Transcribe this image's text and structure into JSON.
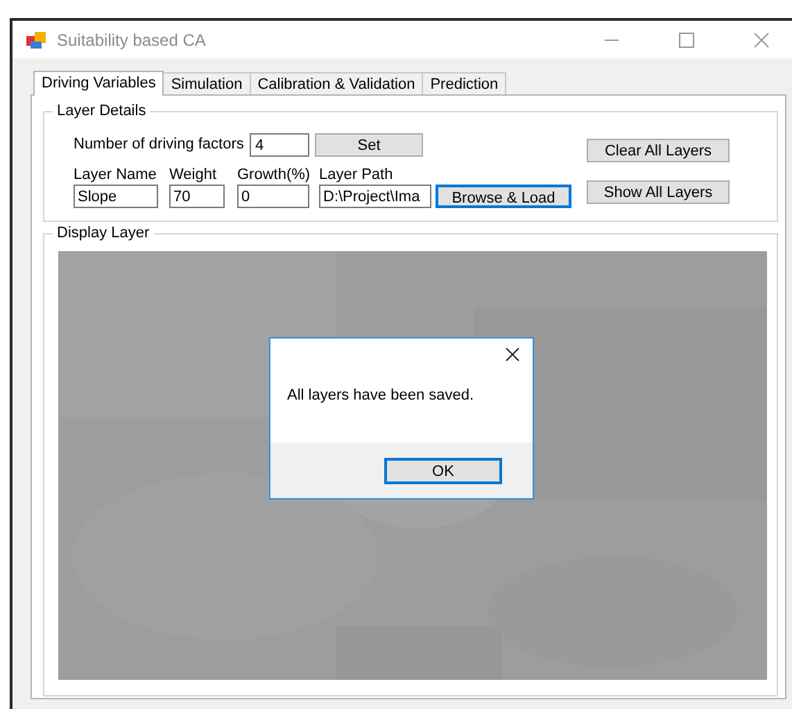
{
  "window": {
    "title": "Suitability based CA"
  },
  "tabs": [
    {
      "label": "Driving Variables",
      "selected": true
    },
    {
      "label": "Simulation",
      "selected": false
    },
    {
      "label": "Calibration & Validation",
      "selected": false
    },
    {
      "label": "Prediction",
      "selected": false
    }
  ],
  "layer_details": {
    "title": "Layer Details",
    "factors_label": "Number of driving factors",
    "factors_value": "4",
    "set_button": "Set",
    "clear_button": "Clear All Layers",
    "fields": [
      {
        "label": "Layer Name",
        "value": "Slope"
      },
      {
        "label": "Weight",
        "value": "70"
      },
      {
        "label": "Growth(%)",
        "value": "0"
      },
      {
        "label": "Layer Path",
        "value": "D:\\Project\\Ima"
      }
    ],
    "browse_button": "Browse & Load",
    "show_button": "Show All Layers"
  },
  "display_layer": {
    "title": "Display Layer"
  },
  "dialog": {
    "message": "All layers have been saved.",
    "ok_button": "OK"
  }
}
